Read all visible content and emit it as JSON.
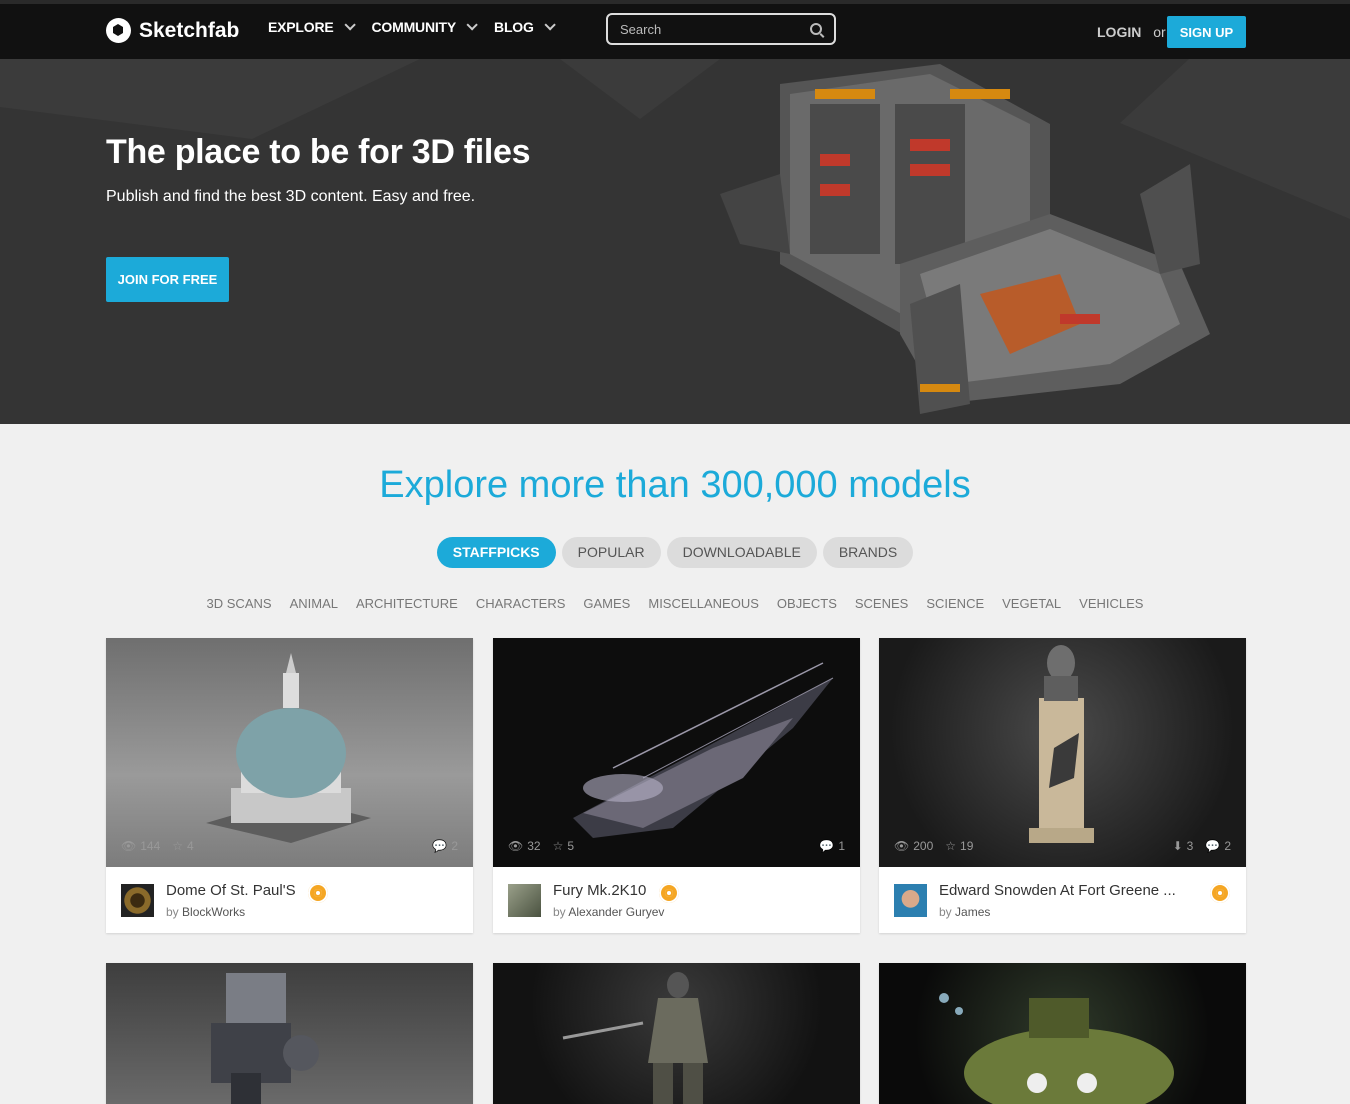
{
  "header": {
    "logo_text": "Sketchfab",
    "nav": [
      {
        "label": "EXPLORE"
      },
      {
        "label": "COMMUNITY"
      },
      {
        "label": "BLOG"
      }
    ],
    "search_placeholder": "Search",
    "login_label": "LOGIN",
    "or_label": "or",
    "signup_label": "SIGN UP"
  },
  "hero": {
    "title": "The place to be for 3D files",
    "subtitle": "Publish and find the best 3D content. Easy and free.",
    "cta_label": "JOIN FOR FREE"
  },
  "explore": {
    "title": "Explore more than 300,000 models",
    "tabs": [
      {
        "label": "STAFFPICKS",
        "active": true
      },
      {
        "label": "POPULAR"
      },
      {
        "label": "DOWNLOADABLE"
      },
      {
        "label": "BRANDS"
      }
    ],
    "categories": [
      "3D SCANS",
      "ANIMAL",
      "ARCHITECTURE",
      "CHARACTERS",
      "GAMES",
      "MISCELLANEOUS",
      "OBJECTS",
      "SCENES",
      "SCIENCE",
      "VEGETAL",
      "VEHICLES"
    ]
  },
  "cards": [
    {
      "title": "Dome Of St. Paul'S",
      "by": "by",
      "author": "BlockWorks",
      "views": "144",
      "likes": "4",
      "downloads": "",
      "comments": "2"
    },
    {
      "title": "Fury Mk.2K10",
      "by": "by",
      "author": "Alexander Guryev",
      "views": "32",
      "likes": "5",
      "downloads": "",
      "comments": "1"
    },
    {
      "title": "Edward Snowden At Fort Greene ...",
      "by": "by",
      "author": "James",
      "views": "200",
      "likes": "19",
      "downloads": "3",
      "comments": "2"
    }
  ],
  "colors": {
    "accent": "#1caad9",
    "header_bg": "#111111",
    "hero_bg": "#343434",
    "badge": "#f5a623",
    "page_bg": "#f0f0f0"
  },
  "icons": {
    "views": "eye-icon",
    "likes": "star-icon",
    "downloads": "download-icon",
    "comments": "comment-icon",
    "staffpick": "staffpick-badge-icon"
  }
}
